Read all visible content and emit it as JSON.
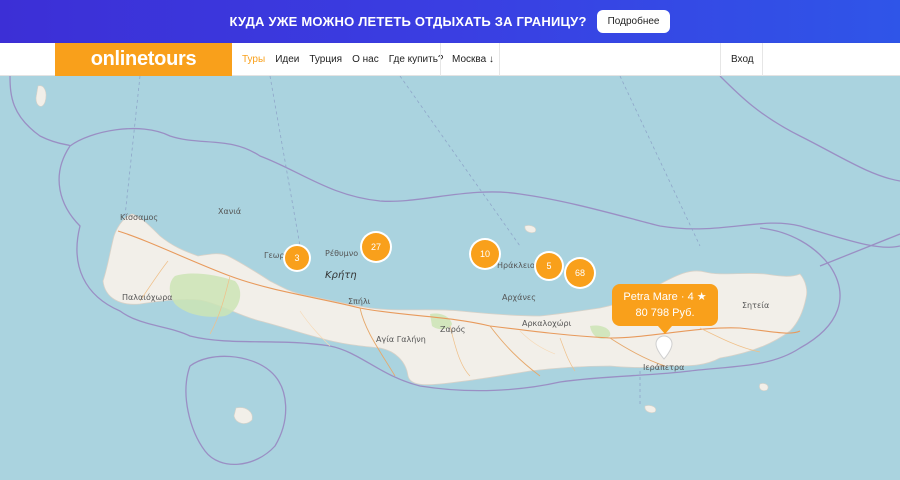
{
  "promo": {
    "text": "КУДА УЖЕ МОЖНО ЛЕТЕТЬ ОТДЫХАТЬ ЗА ГРАНИЦУ?",
    "button": "Подробнее"
  },
  "nav": {
    "logo": "onlinetours",
    "items": [
      "Туры",
      "Идеи",
      "Турция",
      "О нас",
      "Где купить?"
    ],
    "city": "Москва ↓",
    "login": "Вход"
  },
  "map": {
    "colors": {
      "sea": "#aad3df",
      "land": "#f2efe9",
      "cluster": "#f9a01b",
      "accent": "#f9a01b"
    },
    "clusters": [
      "3",
      "27",
      "10",
      "5",
      "68"
    ],
    "places": {
      "kissamos": "Κίσσαμος",
      "chania": "Χανιά",
      "rethymno": "Ρέθυμνο",
      "crete": "Κρήτη",
      "heraklion": "Ηράκλειο",
      "spili": "Σπήλι",
      "zaros": "Ζαρός",
      "agia_galini": "Αγία Γαλήνη",
      "archanes": "Αρχάνες",
      "arkalochori": "Αρκαλοχώρι",
      "paleochora": "Παλαιόχωρα",
      "ierapetra": "Ιεράπετρα",
      "sitia": "Σητεία",
      "georgioupoli": "Γεωρ"
    },
    "popup": {
      "hotel": "Petra Mare",
      "stars": "4",
      "star_icon": "star-icon",
      "price": "80 798 Руб."
    }
  }
}
